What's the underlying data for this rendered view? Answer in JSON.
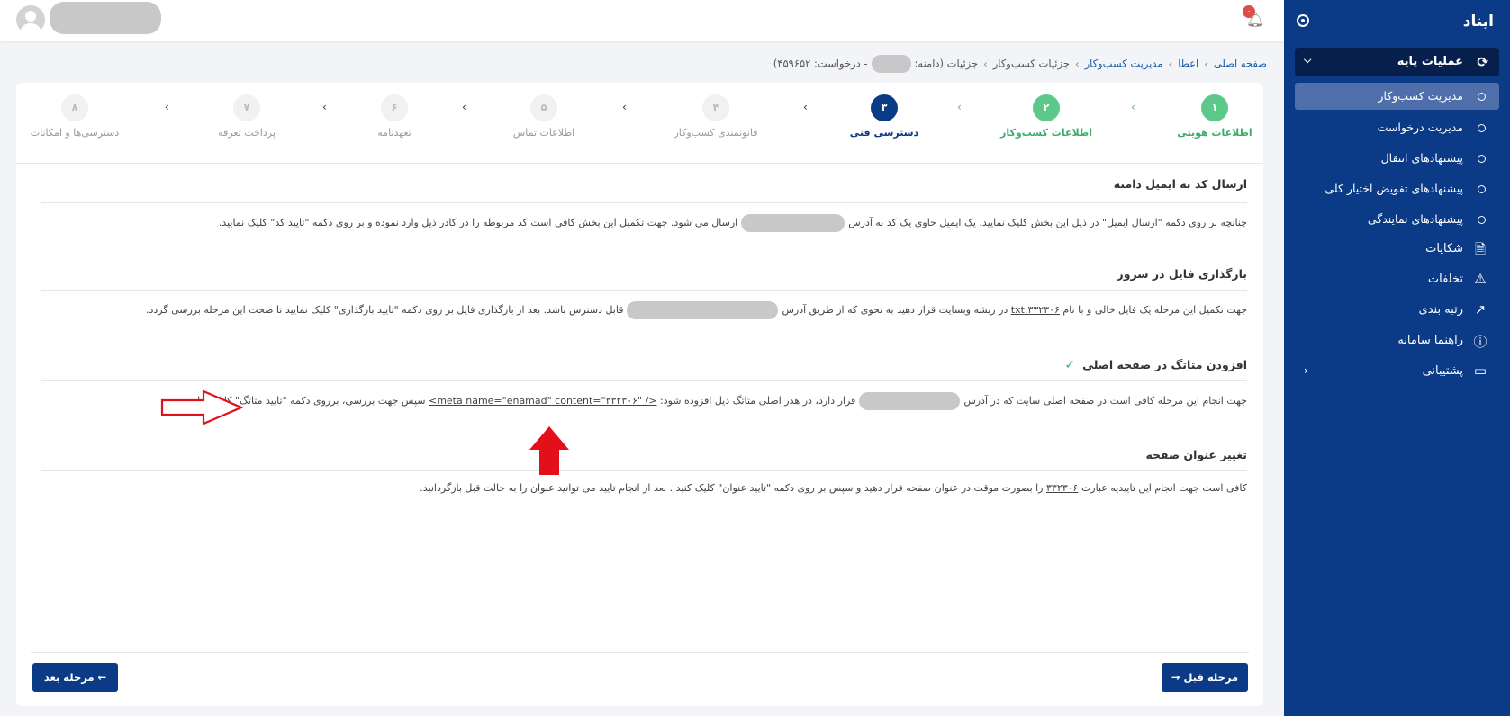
{
  "sidebar": {
    "title": "ایناد",
    "group": "عملیات پایه",
    "subitems": [
      "مدیریت کسب‌وکار",
      "مدیریت درخواست",
      "پیشنهادهای انتقال",
      "پیشنهادهای تفویض اختیار کلی",
      "پیشنهادهای نمایندگی"
    ],
    "items": [
      "شکایات",
      "تخلفات",
      "رتبه بندی",
      "راهنما سامانه",
      "پشتیبانی"
    ]
  },
  "topbar": {
    "badge": "۰"
  },
  "breadcrumb": {
    "home": "صفحه اصلی",
    "b2": "اعطا",
    "b3": "مدیریت کسب‌وکار",
    "b4": "جزئیات کسب‌وکار",
    "b5_pre": "جزئیات (دامنه:",
    "b5_post": "- درخواست: ۴۵۹۶۵۲)"
  },
  "steps": [
    {
      "num": "۱",
      "label": "اطلاعات هویتی",
      "state": "done"
    },
    {
      "num": "۲",
      "label": "اطلاعات کسب‌وکار",
      "state": "done"
    },
    {
      "num": "۳",
      "label": "دسترسی فنی",
      "state": "current"
    },
    {
      "num": "۴",
      "label": "قانونمندی کسب‌وکار",
      "state": "todo"
    },
    {
      "num": "۵",
      "label": "اطلاعات تماس",
      "state": "todo"
    },
    {
      "num": "۶",
      "label": "تعهدنامه",
      "state": "todo"
    },
    {
      "num": "۷",
      "label": "پرداخت تعرفه",
      "state": "todo"
    },
    {
      "num": "۸",
      "label": "دسترسی‌ها و امکانات",
      "state": "todo"
    }
  ],
  "sections": {
    "email": {
      "title": "ارسال کد به ایمیل دامنه",
      "t1": "چنانچه بر روی دکمه \"ارسال ایمیل\" در ذیل این بخش کلیک نمایید، یک ایمیل حاوی یک کد به آدرس",
      "t2": "ارسال می شود. جهت تکمیل این بخش کافی است کد مربوطه را در کادر ذیل وارد نموده و بر روی دکمه \"تایید کد\" کلیک نمایید."
    },
    "file": {
      "title": "بارگذاری فایل در سرور",
      "t1": "جهت تکمیل این مرحله یک فایل خالی و با نام",
      "fname": "۳۳۲۳۰۶.txt",
      "t2": "در ریشه وبسایت قرار دهید به نحوی که از طریق آدرس",
      "t3": "قابل دسترس باشد. بعد از بارگذاری فایل بر روی دکمه \"تایید بارگذاری\" کلیک نمایید تا صحت این مرحله بررسی گردد."
    },
    "meta": {
      "title": "افزودن متاتگ در صفحه اصلی",
      "t1": "جهت انجام این مرحله کافی است در صفحه اصلی سایت که در آدرس",
      "t2": "قرار دارد، در هدر اصلی متاتگ ذیل افزوده شود:",
      "tag": "<meta name=\"enamad\" content=\"۳۳۲۳۰۶\" />",
      "t3": "سپس جهت بررسی، برروی دکمه \"تایید متاتگ\" کلیک نمایید."
    },
    "title_change": {
      "title": "تغییر عنوان صفحه",
      "t1": "کافی است جهت انجام این تاییدیه عبارت",
      "code": "۳۳۲۳۰۶",
      "t2": "را بصورت موقت در عنوان صفحه قرار دهید و سپس بر روی دکمه \"تایید عنوان\" کلیک کنید . بعد از انجام تایید می توانید عنوان را به حالت قبل بازگردانید."
    }
  },
  "buttons": {
    "prev": "→ مرحله قبل",
    "next": "مرحله بعد ←"
  }
}
